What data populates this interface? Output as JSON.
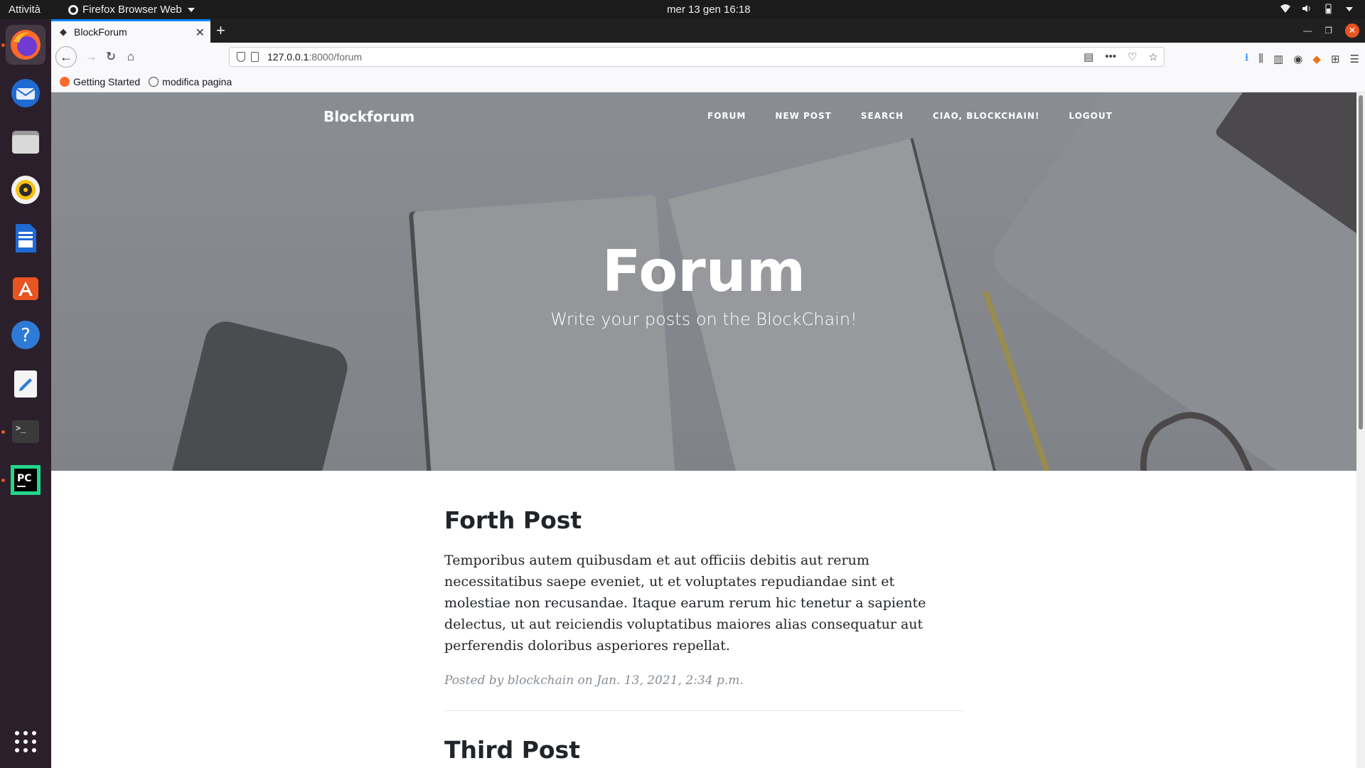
{
  "system": {
    "activities": "Attività",
    "app_name": "Firefox Browser Web",
    "clock": "mer 13 gen  16:18"
  },
  "browser": {
    "tab_title": "BlockForum",
    "url_host": "127.0.0.1",
    "url_path": ":8000/forum",
    "bookmarks": [
      "Getting Started",
      "modifica pagina"
    ]
  },
  "site": {
    "brand": "Blockforum",
    "nav": [
      "FORUM",
      "NEW POST",
      "SEARCH",
      "CIAO, BLOCKCHAIN!",
      "LOGOUT"
    ],
    "hero_title": "Forum",
    "hero_subtitle": "Write your posts on the BlockChain!"
  },
  "posts": [
    {
      "title": "Forth Post",
      "body": "Temporibus autem quibusdam et aut officiis debitis aut rerum necessitatibus saepe eveniet, ut et voluptates repudiandae sint et molestiae non recusandae. Itaque earum rerum hic tenetur a sapiente delectus, ut aut reiciendis voluptatibus maiores alias consequatur aut perferendis doloribus asperiores repellat.",
      "meta": "Posted by blockchain on Jan. 13, 2021, 2:34 p.m."
    },
    {
      "title": "Third Post"
    }
  ],
  "colors": {
    "accent": "#0a84ff",
    "ubuntu_orange": "#e95420",
    "dock_bg": "#2c1f2c"
  },
  "icons": {
    "dock": [
      "firefox-icon",
      "thunderbird-icon",
      "files-icon",
      "rhythmbox-icon",
      "writer-icon",
      "software-icon",
      "help-icon",
      "text-editor-icon",
      "terminal-icon",
      "pycharm-icon",
      "app-grid-icon"
    ]
  }
}
